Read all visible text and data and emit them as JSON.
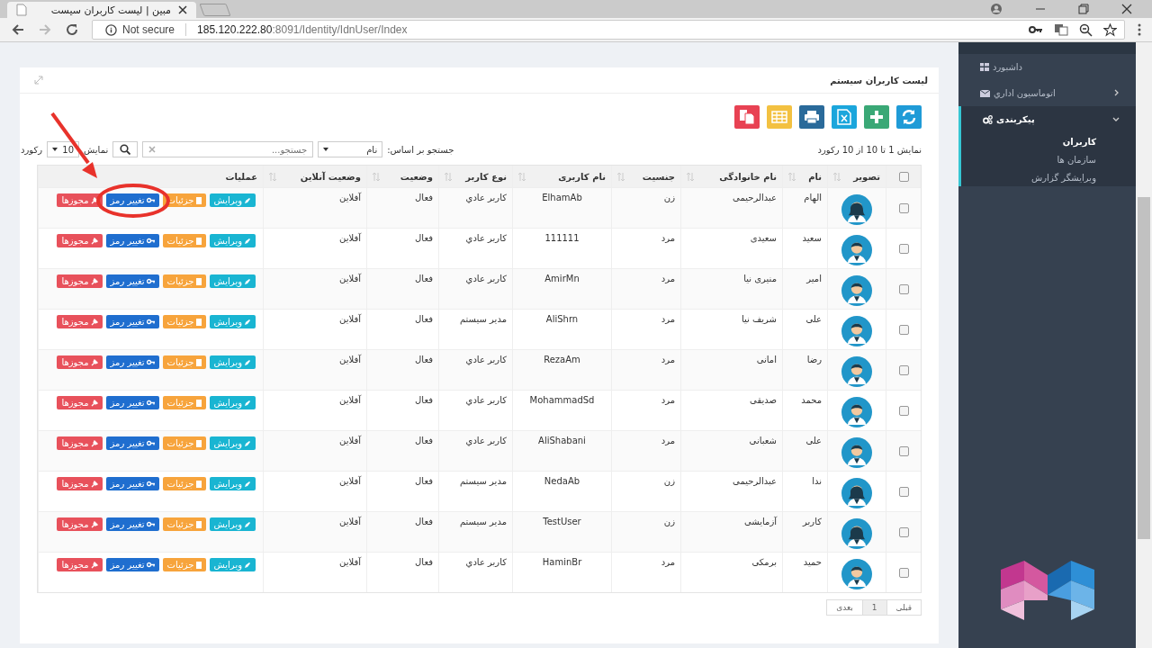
{
  "browser": {
    "tab_title": "مبین | لیست کاربران سیست",
    "security": "Not secure",
    "url_host": "185.120.222.80",
    "url_rest": ":8091/Identity/IdnUser/Index"
  },
  "sidebar": {
    "items": [
      {
        "label": "داشبورد"
      },
      {
        "label": "اتوماسیون اداري",
        "expanded": false
      },
      {
        "label": "پیکربندی",
        "expanded": true,
        "children": [
          {
            "label": "کاربران",
            "selected": true
          },
          {
            "label": "سازمان ها",
            "selected": false
          },
          {
            "label": "ویرایشگر گزارش",
            "selected": false
          }
        ]
      }
    ]
  },
  "card": {
    "title": "لیست کاربران سیستم"
  },
  "toolbar": [
    {
      "kind": "refresh"
    },
    {
      "kind": "add"
    },
    {
      "kind": "excel"
    },
    {
      "kind": "print"
    },
    {
      "kind": "grid"
    },
    {
      "kind": "pdf"
    }
  ],
  "info": "نمایش 1 تا 10 از 10 رکورد",
  "search": {
    "by_label": "جستجو بر اساس:",
    "by_value": "نام",
    "placeholder": "جستجو...",
    "show_label": "نمایش",
    "page_size": "10",
    "records_label": "رکورد"
  },
  "table": {
    "all_checked": false,
    "columns": [
      {
        "label": "تصویر",
        "sortable": true
      },
      {
        "label": "نام",
        "sortable": true
      },
      {
        "label": "نام خانوادگی",
        "sortable": true
      },
      {
        "label": "جنسیت",
        "sortable": true
      },
      {
        "label": "نام کاربری",
        "sortable": true
      },
      {
        "label": "نوع کاربر",
        "sortable": true
      },
      {
        "label": "وضعیت",
        "sortable": true
      },
      {
        "label": "وضعیت آنلاین",
        "sortable": true
      },
      {
        "label": "عملیات",
        "sortable": false
      }
    ],
    "rows": [
      {
        "checked": false,
        "kind": "female",
        "cells": [
          "",
          "الهام",
          "عبدالرحیمی",
          "زن",
          "ElhamAb",
          "کاربر عادي",
          "فعال",
          "آفلاین"
        ],
        "actions": [
          {
            "kind": "edit",
            "label": "ویرایش"
          },
          {
            "kind": "details",
            "label": "جزئیات"
          },
          {
            "kind": "password",
            "label": "تغییر رمز"
          },
          {
            "kind": "permissions",
            "label": "مجوزها"
          }
        ]
      },
      {
        "checked": false,
        "kind": "male",
        "cells": [
          "",
          "سعید",
          "سعیدی",
          "مرد",
          "111111",
          "کاربر عادي",
          "فعال",
          "آفلاین"
        ],
        "actions": [
          {
            "kind": "edit",
            "label": "ویرایش"
          },
          {
            "kind": "details",
            "label": "جزئیات"
          },
          {
            "kind": "password",
            "label": "تغییر رمز"
          },
          {
            "kind": "permissions",
            "label": "مجوزها"
          }
        ]
      },
      {
        "checked": false,
        "kind": "male",
        "cells": [
          "",
          "امیر",
          "منیری نیا",
          "مرد",
          "AmirMn",
          "کاربر عادي",
          "فعال",
          "آفلاین"
        ],
        "actions": [
          {
            "kind": "edit",
            "label": "ویرایش"
          },
          {
            "kind": "details",
            "label": "جزئیات"
          },
          {
            "kind": "password",
            "label": "تغییر رمز"
          },
          {
            "kind": "permissions",
            "label": "مجوزها"
          }
        ]
      },
      {
        "checked": false,
        "kind": "male",
        "cells": [
          "",
          "علی",
          "شریف نیا",
          "مرد",
          "AliShrn",
          "مدیر سیستم",
          "فعال",
          "آفلاین"
        ],
        "actions": [
          {
            "kind": "edit",
            "label": "ویرایش"
          },
          {
            "kind": "details",
            "label": "جزئیات"
          },
          {
            "kind": "password",
            "label": "تغییر رمز"
          },
          {
            "kind": "permissions",
            "label": "مجوزها"
          }
        ]
      },
      {
        "checked": false,
        "kind": "male",
        "cells": [
          "",
          "رضا",
          "امانی",
          "مرد",
          "RezaAm",
          "کاربر عادي",
          "فعال",
          "آفلاین"
        ],
        "actions": [
          {
            "kind": "edit",
            "label": "ویرایش"
          },
          {
            "kind": "details",
            "label": "جزئیات"
          },
          {
            "kind": "password",
            "label": "تغییر رمز"
          },
          {
            "kind": "permissions",
            "label": "مجوزها"
          }
        ]
      },
      {
        "checked": false,
        "kind": "male",
        "cells": [
          "",
          "محمد",
          "صدیقی",
          "مرد",
          "MohammadSd",
          "کاربر عادي",
          "فعال",
          "آفلاین"
        ],
        "actions": [
          {
            "kind": "edit",
            "label": "ویرایش"
          },
          {
            "kind": "details",
            "label": "جزئیات"
          },
          {
            "kind": "password",
            "label": "تغییر رمز"
          },
          {
            "kind": "permissions",
            "label": "مجوزها"
          }
        ]
      },
      {
        "checked": false,
        "kind": "male",
        "cells": [
          "",
          "علی",
          "شعبانی",
          "مرد",
          "AliShabani",
          "کاربر عادي",
          "فعال",
          "آفلاین"
        ],
        "actions": [
          {
            "kind": "edit",
            "label": "ویرایش"
          },
          {
            "kind": "details",
            "label": "جزئیات"
          },
          {
            "kind": "password",
            "label": "تغییر رمز"
          },
          {
            "kind": "permissions",
            "label": "مجوزها"
          }
        ]
      },
      {
        "checked": false,
        "kind": "female",
        "cells": [
          "",
          "ندا",
          "عبدالرحیمی",
          "زن",
          "NedaAb",
          "مدیر سیستم",
          "فعال",
          "آفلاین"
        ],
        "actions": [
          {
            "kind": "edit",
            "label": "ویرایش"
          },
          {
            "kind": "details",
            "label": "جزئیات"
          },
          {
            "kind": "password",
            "label": "تغییر رمز"
          },
          {
            "kind": "permissions",
            "label": "مجوزها"
          }
        ]
      },
      {
        "checked": false,
        "kind": "female",
        "cells": [
          "",
          "کاربر",
          "آزمایشی",
          "زن",
          "TestUser",
          "مدیر سیستم",
          "فعال",
          "آفلاین"
        ],
        "actions": [
          {
            "kind": "edit",
            "label": "ویرایش"
          },
          {
            "kind": "details",
            "label": "جزئیات"
          },
          {
            "kind": "password",
            "label": "تغییر رمز"
          },
          {
            "kind": "permissions",
            "label": "مجوزها"
          }
        ]
      },
      {
        "checked": false,
        "kind": "male",
        "cells": [
          "",
          "حمید",
          "برمکی",
          "مرد",
          "HaminBr",
          "کاربر عادي",
          "فعال",
          "آفلاین"
        ],
        "actions": [
          {
            "kind": "edit",
            "label": "ویرایش"
          },
          {
            "kind": "details",
            "label": "جزئیات"
          },
          {
            "kind": "password",
            "label": "تغییر رمز"
          },
          {
            "kind": "permissions",
            "label": "مجوزها"
          }
        ]
      }
    ]
  },
  "pagination": [
    {
      "label": "قبلی",
      "selected": false
    },
    {
      "label": "1",
      "selected": true
    },
    {
      "label": "بعدی",
      "selected": false
    }
  ],
  "annotation": {
    "kind": "arrow-circle"
  }
}
